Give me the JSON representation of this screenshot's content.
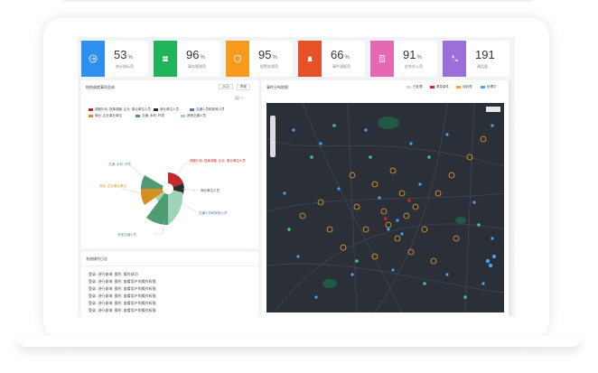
{
  "stats": [
    {
      "value": "53",
      "unit": "%",
      "label": "统计指标项",
      "color": "#2e8ff0",
      "icon": "arrow-icon"
    },
    {
      "value": "96",
      "unit": "%",
      "label": "事务管理项",
      "color": "#1fb35a",
      "icon": "people-icon"
    },
    {
      "value": "95",
      "unit": "%",
      "label": "报警处理项",
      "color": "#f79a1e",
      "icon": "shield-icon"
    },
    {
      "value": "66",
      "unit": "%",
      "label": "事件通报项",
      "color": "#e8502a",
      "icon": "bell-icon"
    },
    {
      "value": "91",
      "unit": "%",
      "label": "综合办公项",
      "color": "#e667b4",
      "icon": "document-icon"
    },
    {
      "value": "191",
      "unit": "",
      "label": "通话量",
      "color": "#9b6fd8",
      "icon": "phone-icon"
    }
  ],
  "left_panel": {
    "title": "结构调度事项总体",
    "year": "2020",
    "select": "季度",
    "legend": [
      {
        "label": "调度行动, 指挥调度, 企业, 事业单位人员",
        "color": "#c2282c"
      },
      {
        "label": "商业单位人员",
        "color": "#2c2c2c"
      },
      {
        "label": "交通人员和其他人员",
        "color": "#4c7db9"
      },
      {
        "label": "商业, 企业事业单位",
        "color": "#d49022"
      },
      {
        "label": "交通, 水利, 环境",
        "color": "#4f9b74"
      },
      {
        "label": "其他交通人员",
        "color": "#9dd3b6"
      }
    ],
    "chart_labels": [
      "调度行动, 指挥调度, 企业, 事业单位人员",
      "商业单位人员",
      "交通人员和其他人员",
      "商业, 企业事业单位",
      "交通, 水利, 环境",
      "其他交通人员"
    ]
  },
  "map_panel": {
    "title": "事件分布地图",
    "legend": [
      {
        "label": "已处理",
        "color": "#d9d9d9"
      },
      {
        "label": "紧急事件",
        "color": "#d92323"
      },
      {
        "label": "待处理",
        "color": "#f3a32b"
      },
      {
        "label": "处理中",
        "color": "#48a4f5"
      }
    ]
  },
  "log_panel": {
    "title": "系统操作日志",
    "lines": [
      "登录, 进行查询: 操作, 操作成功",
      "登录, 进行查询: 操作, 查看用户的操作权限",
      "登录, 进行查询: 操作, 查看用户的操作权限",
      "登录, 进行查询: 操作, 查看用户的操作权限",
      "登录, 进行查询: 操作, 查看用户的操作权限",
      "登录, 进行查询: 操作, 查看用户的操作权限"
    ]
  }
}
